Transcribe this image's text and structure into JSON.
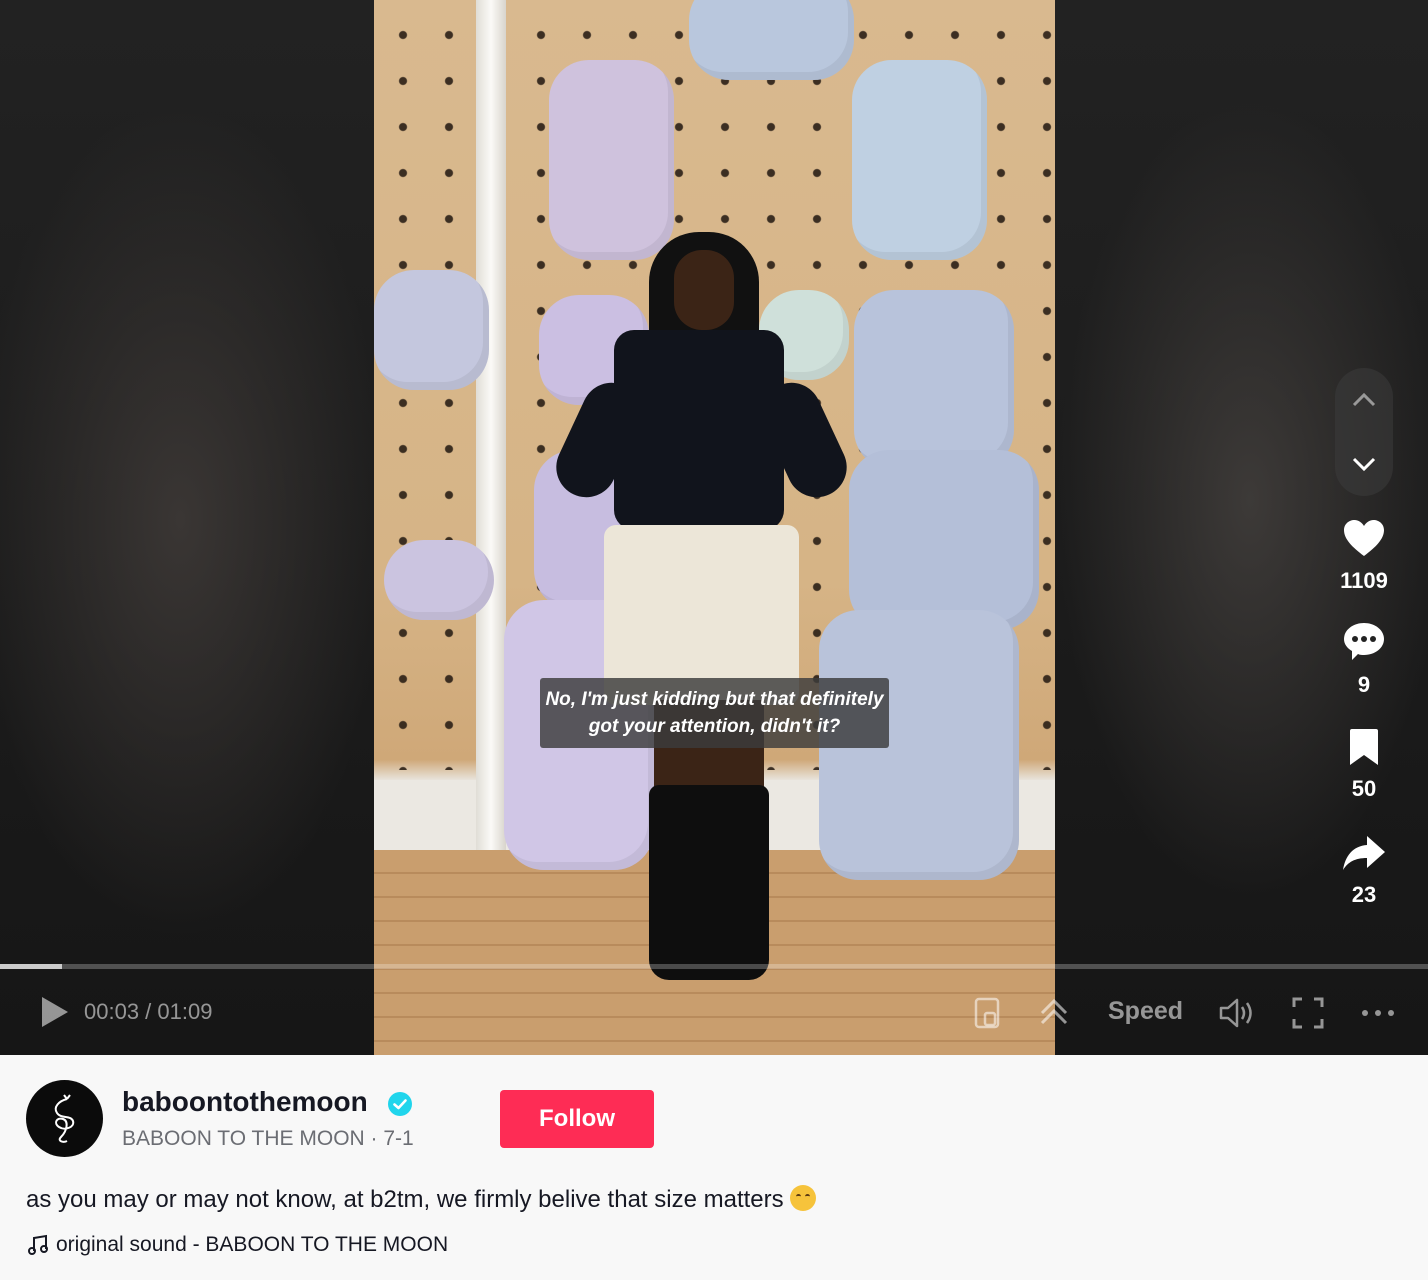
{
  "video": {
    "subtitle_line1": "No, I'm just kidding but that definitely",
    "subtitle_line2": "got your attention, didn't it?",
    "progress": 0.0435
  },
  "controls": {
    "time": "00:03 / 01:09",
    "speed_label": "Speed"
  },
  "actions": {
    "likes": "1109",
    "comments": "9",
    "saves": "50",
    "shares": "23"
  },
  "author": {
    "username": "baboontothemoon",
    "display_line": "BABOON TO THE MOON · 7-1",
    "follow_label": "Follow"
  },
  "post": {
    "caption": "as you may or may not know, at b2tm, we firmly belive that size matters",
    "music": "original sound - BABOON TO THE MOON"
  },
  "colors": {
    "follow": "#fe2c55",
    "verified": "#20d5ec"
  }
}
